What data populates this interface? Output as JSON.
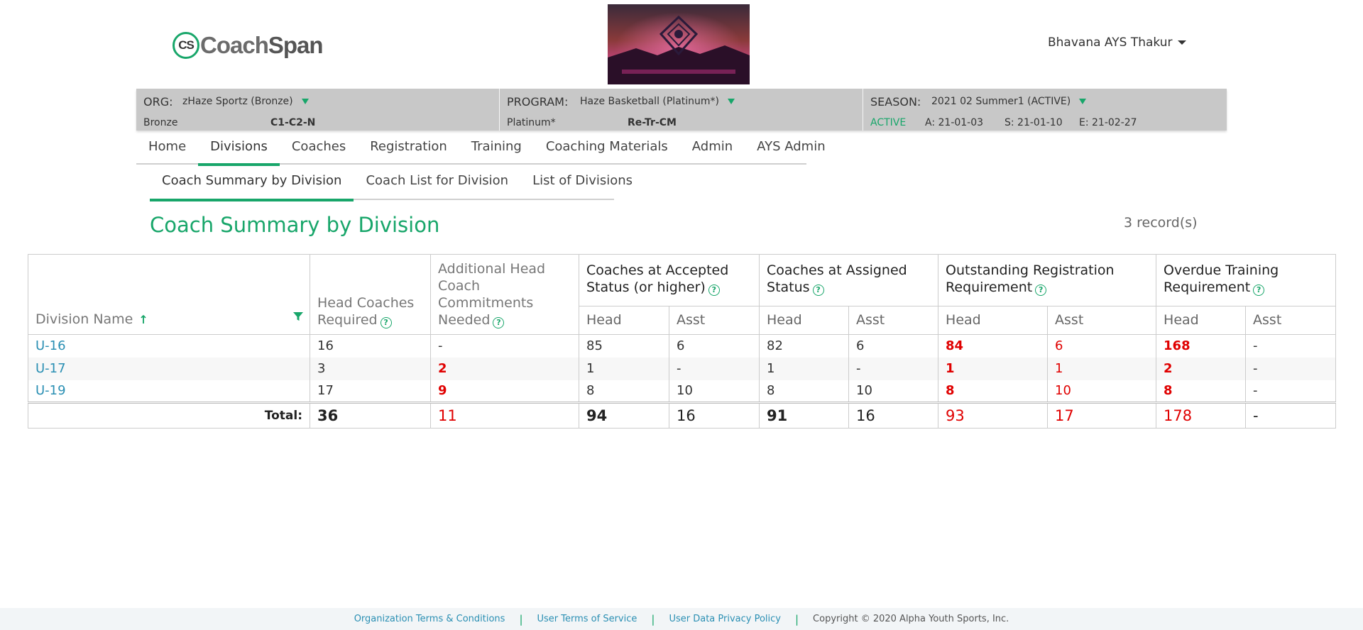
{
  "header": {
    "logo_mark": "CS",
    "logo_text_a": "Coach",
    "logo_text_b": "Span",
    "user_name": "Bhavana AYS Thakur"
  },
  "context": {
    "org": {
      "label": "ORG:",
      "value": "zHaze Sportz (Bronze)",
      "tier": "Bronze",
      "code": "C1-C2-N"
    },
    "program": {
      "label": "PROGRAM:",
      "value": "Haze Basketball (Platinum*)",
      "tier": "Platinum*",
      "code": "Re-Tr-CM"
    },
    "season": {
      "label": "SEASON:",
      "value": "2021 02 Summer1 (ACTIVE)",
      "status": "ACTIVE",
      "a": "A: 21-01-03",
      "s": "S: 21-01-10",
      "e": "E: 21-02-27"
    }
  },
  "nav": {
    "items": [
      "Home",
      "Divisions",
      "Coaches",
      "Registration",
      "Training",
      "Coaching Materials",
      "Admin",
      "AYS Admin"
    ],
    "active": "Divisions"
  },
  "subnav": {
    "items": [
      "Coach Summary by Division",
      "Coach List for Division",
      "List of Divisions"
    ],
    "active": "Coach Summary by Division"
  },
  "page": {
    "title": "Coach Summary by Division",
    "records": "3 record(s)"
  },
  "table": {
    "headers": {
      "division": "Division Name",
      "head_req": "Head Coaches Required",
      "add_head": "Additional Head Coach Commitments Needed",
      "accepted": "Coaches at Accepted Status (or higher)",
      "assigned": "Coaches at Assigned Status",
      "outstanding": "Outstanding Registration Requirement",
      "overdue": "Overdue Training Requirement",
      "head": "Head",
      "asst": "Asst"
    },
    "rows": [
      {
        "division": "U-16",
        "head_req": "16",
        "add_head": "-",
        "acc_head": "85",
        "acc_asst": "6",
        "asg_head": "82",
        "asg_asst": "6",
        "out_head": "84",
        "out_asst": "6",
        "ovd_head": "168",
        "ovd_asst": "-"
      },
      {
        "division": "U-17",
        "head_req": "3",
        "add_head": "2",
        "acc_head": "1",
        "acc_asst": "-",
        "asg_head": "1",
        "asg_asst": "-",
        "out_head": "1",
        "out_asst": "1",
        "ovd_head": "2",
        "ovd_asst": "-"
      },
      {
        "division": "U-19",
        "head_req": "17",
        "add_head": "9",
        "acc_head": "8",
        "acc_asst": "10",
        "asg_head": "8",
        "asg_asst": "10",
        "out_head": "8",
        "out_asst": "10",
        "ovd_head": "8",
        "ovd_asst": "-"
      }
    ],
    "totals": {
      "label": "Total:",
      "head_req": "36",
      "add_head": "11",
      "acc_head": "94",
      "acc_asst": "16",
      "asg_head": "91",
      "asg_asst": "16",
      "out_head": "93",
      "out_asst": "17",
      "ovd_head": "178",
      "ovd_asst": "-"
    }
  },
  "footer": {
    "links": [
      "Organization Terms & Conditions",
      "User Terms of Service",
      "User Data Privacy Policy"
    ],
    "copyright": "Copyright © 2020 Alpha Youth Sports, Inc."
  },
  "colors": {
    "brand_green": "#18a66a",
    "link_blue": "#2a8fb3",
    "alert_red": "#e00000",
    "context_bar_gray": "#c8c8c8"
  },
  "icons": [
    "caret-down-icon",
    "dropdown-triangle-icon",
    "help-icon",
    "sort-ascending-icon",
    "filter-icon"
  ]
}
